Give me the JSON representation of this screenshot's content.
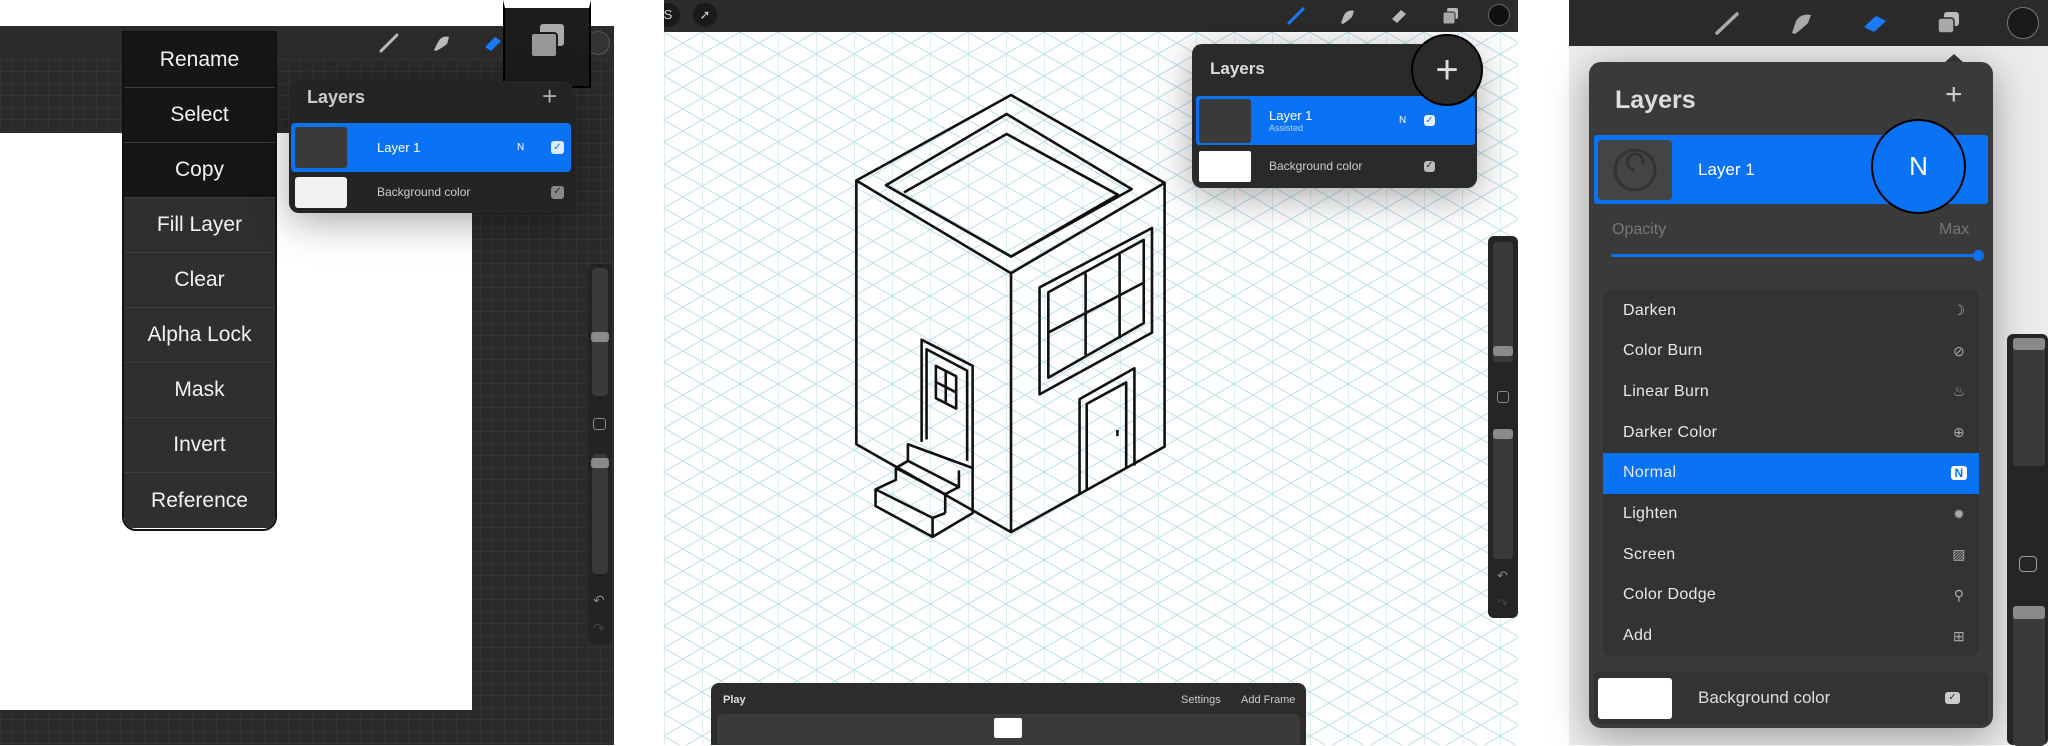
{
  "colors": {
    "accent": "#0a72f5",
    "toolbar": "#2b2b2b",
    "panel": "#242424",
    "grid": "#bfe0ea"
  },
  "panel1": {
    "toolbar_icons": [
      "brush-icon",
      "smudge-icon",
      "eraser-icon",
      "layers-icon",
      "color-icon"
    ],
    "context_menu": [
      "Rename",
      "Select",
      "Copy",
      "Fill Layer",
      "Clear",
      "Alpha Lock",
      "Mask",
      "Invert",
      "Reference"
    ],
    "layers": {
      "title": "Layers",
      "add": "+",
      "items": [
        {
          "name": "Layer 1",
          "blend": "N",
          "visible": true,
          "selected": true
        },
        {
          "name": "Background color",
          "visible": true
        }
      ]
    }
  },
  "panel2": {
    "layers": {
      "title": "Layers",
      "add": "+",
      "items": [
        {
          "name": "Layer 1",
          "sub": "Assisted",
          "blend": "N",
          "visible": true,
          "selected": true
        },
        {
          "name": "Background color",
          "visible": true
        }
      ]
    },
    "animation": {
      "play": "Play",
      "settings": "Settings",
      "add_frame": "Add Frame"
    }
  },
  "panel3": {
    "layers": {
      "title": "Layers",
      "add": "+",
      "layer": "Layer 1",
      "blend_badge": "N",
      "opacity_label": "Opacity",
      "opacity_value_label": "Max",
      "opacity": 1.0,
      "blend_modes": [
        {
          "label": "Darken",
          "icon": "moon-icon"
        },
        {
          "label": "Color Burn",
          "icon": "burn-icon"
        },
        {
          "label": "Linear Burn",
          "icon": "flame-icon"
        },
        {
          "label": "Darker Color",
          "icon": "plus-circle-icon"
        },
        {
          "label": "Normal",
          "icon": "n-badge-icon",
          "selected": true
        },
        {
          "label": "Lighten",
          "icon": "sun-icon"
        },
        {
          "label": "Screen",
          "icon": "hatch-icon"
        },
        {
          "label": "Color Dodge",
          "icon": "dodge-icon"
        },
        {
          "label": "Add",
          "icon": "plus-square-icon"
        }
      ],
      "blend_glyphs": [
        "☽",
        "⊘",
        "♨",
        "⊕",
        "N",
        "✹",
        "▨",
        "⚲",
        "⊞"
      ],
      "background": "Background color"
    }
  }
}
